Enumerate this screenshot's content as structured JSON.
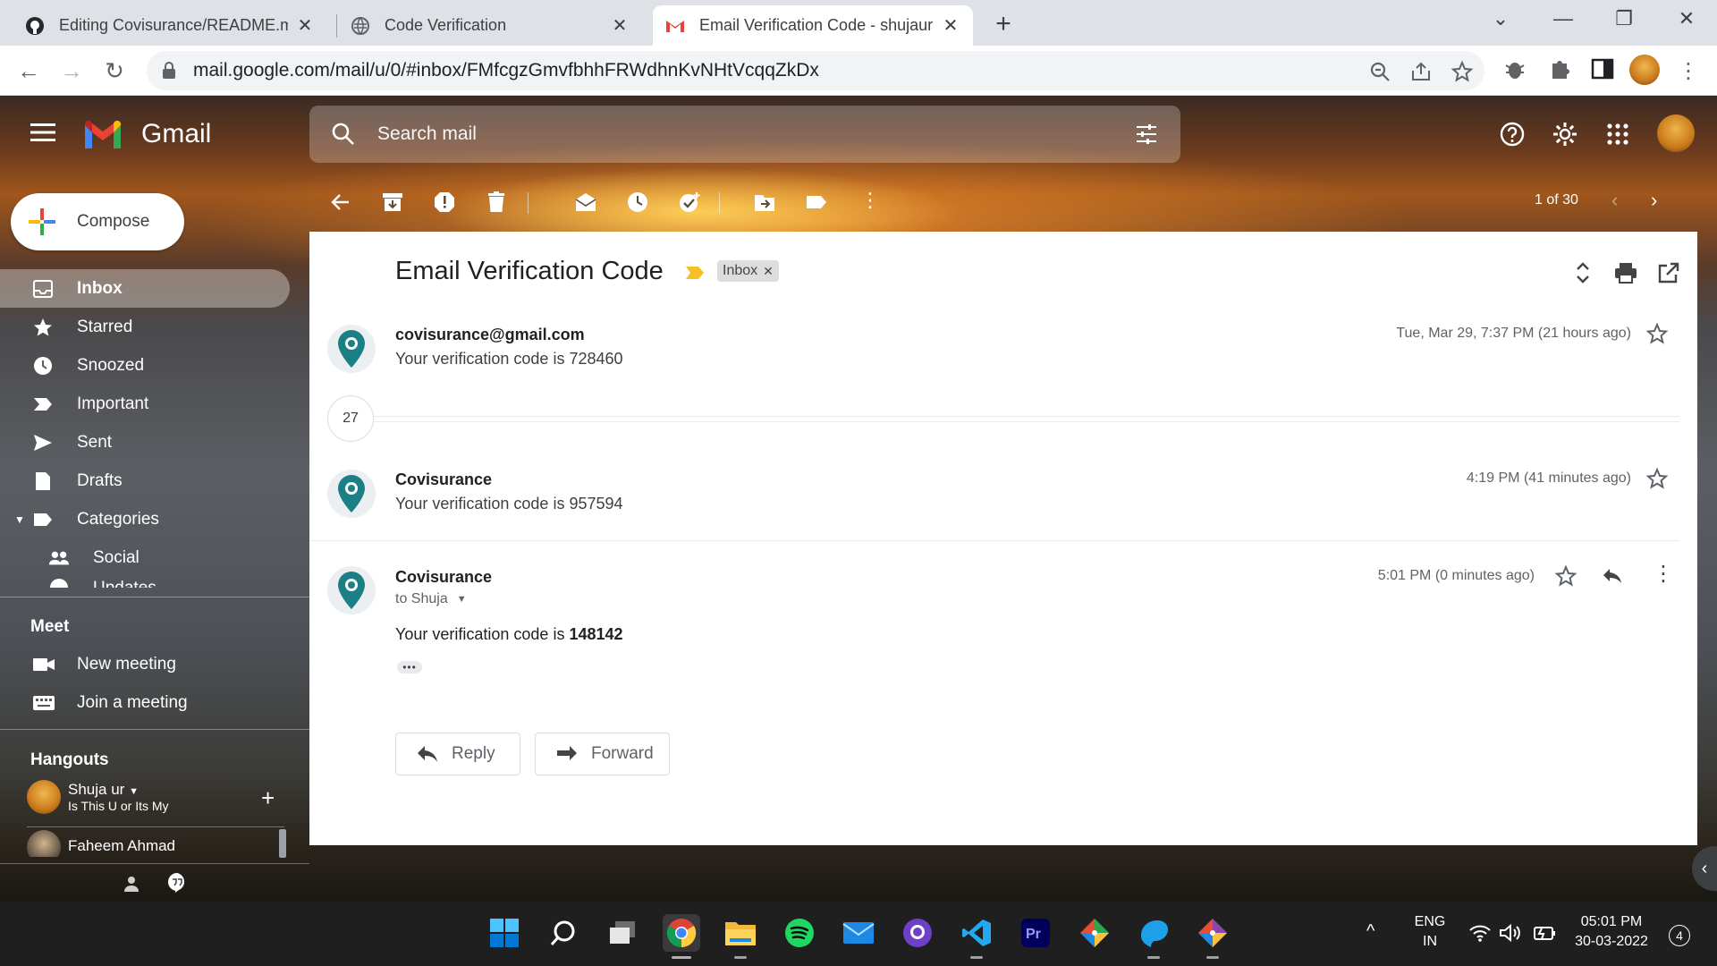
{
  "browser": {
    "tabs": [
      {
        "title": "Editing Covisurance/README.md",
        "favicon": "github-icon",
        "active": false
      },
      {
        "title": "Code Verification",
        "favicon": "globe-icon",
        "active": false
      },
      {
        "title": "Email Verification Code - shujaur",
        "favicon": "gmail-icon",
        "active": true
      }
    ],
    "url": "mail.google.com/mail/u/0/#inbox/FMfcgzGmvfbhhFRWdhnKvNHtVcqqZkDx"
  },
  "gmail": {
    "brand": "Gmail",
    "search_placeholder": "Search mail",
    "compose_label": "Compose",
    "nav": [
      {
        "label": "Inbox",
        "icon": "inbox-icon",
        "active": true
      },
      {
        "label": "Starred",
        "icon": "star-icon"
      },
      {
        "label": "Snoozed",
        "icon": "clock-icon"
      },
      {
        "label": "Important",
        "icon": "important-icon"
      },
      {
        "label": "Sent",
        "icon": "send-icon"
      },
      {
        "label": "Drafts",
        "icon": "draft-icon"
      },
      {
        "label": "Categories",
        "icon": "label-icon"
      },
      {
        "label": "Social",
        "icon": "people-icon"
      },
      {
        "label": "Updates",
        "icon": "info-icon"
      }
    ],
    "meet": {
      "title": "Meet",
      "items": [
        {
          "label": "New meeting",
          "icon": "video-icon"
        },
        {
          "label": "Join a meeting",
          "icon": "keyboard-icon"
        }
      ]
    },
    "hangouts": {
      "title": "Hangouts",
      "contacts": [
        {
          "name": "Shuja ur",
          "status": "Is This U or Its My"
        },
        {
          "name": "Faheem Ahmad",
          "status": ""
        }
      ]
    },
    "pager": "1 of 30",
    "colors": {
      "accent": "#ea4335",
      "chip_bg": "#dddddd",
      "label_arrow": "#f6bf26"
    }
  },
  "thread": {
    "subject": "Email Verification Code",
    "label_chip": "Inbox",
    "collapsed_count": "27",
    "messages": [
      {
        "sender": "covisurance@gmail.com",
        "snippet": "Your verification code is 728460",
        "date": "Tue, Mar 29, 7:37 PM (21 hours ago)"
      },
      {
        "sender": "Covisurance",
        "snippet": "Your verification code is 957594",
        "date": "4:19 PM (41 minutes ago)"
      },
      {
        "sender": "Covisurance",
        "to": "to Shuja",
        "body_prefix": "Your verification code is",
        "code": "148142",
        "date": "5:01 PM (0 minutes ago)"
      }
    ],
    "reply_label": "Reply",
    "forward_label": "Forward"
  },
  "taskbar": {
    "language": "ENG",
    "region": "IN",
    "time": "05:01 PM",
    "date": "30-03-2022",
    "notifications": "4",
    "apps": [
      "windows-start-icon",
      "search-icon",
      "task-view-icon",
      "chrome-icon",
      "file-explorer-icon",
      "spotify-icon",
      "mail-icon",
      "github-desktop-icon",
      "vscode-icon",
      "premiere-pro-icon",
      "git-icon",
      "mysql-workbench-icon",
      "git-icon"
    ]
  }
}
